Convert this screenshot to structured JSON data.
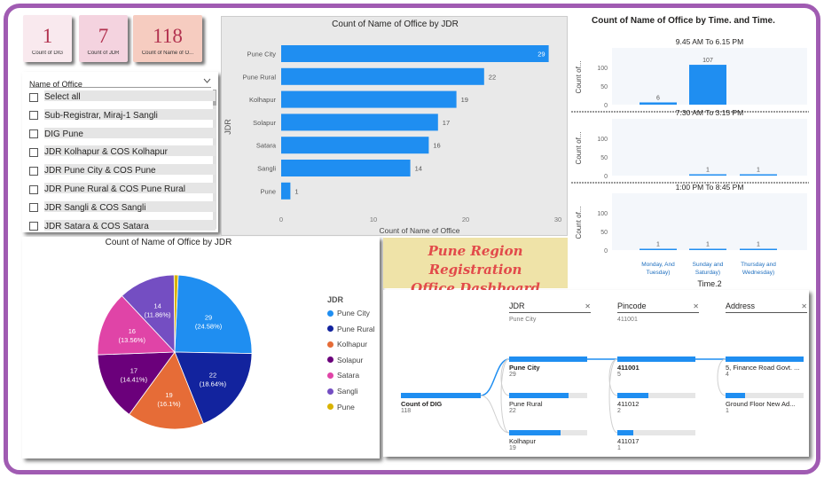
{
  "colors": {
    "frame": "#a05bb2",
    "bar": "#1f8ef1",
    "card_dig": "#f9e9ee",
    "card_jdr": "#f4d3df",
    "card_office": "#f6ccc0",
    "title_bg": "#efe3a8",
    "title_text": "#e24a4a"
  },
  "cards": [
    {
      "value": "1",
      "label": "Count of DIG"
    },
    {
      "value": "7",
      "label": "Count of JDR"
    },
    {
      "value": "118",
      "label": "Count of Name of O..."
    }
  ],
  "slicer": {
    "header": "Name of Office",
    "chevron_icon": "chevron-down-icon",
    "items": [
      "Select all",
      "Sub-Registrar, Miraj-1 Sangli",
      "DIG Pune",
      "JDR Kolhapur & COS Kolhapur",
      "JDR Pune City & COS Pune",
      "JDR Pune Rural & COS Pune Rural",
      "JDR Sangli & COS Sangli",
      "JDR Satara & COS Satara"
    ]
  },
  "dashboard_title": {
    "line1": "Pune Region Registration",
    "line2": "Office Dashboard"
  },
  "bar_panel": {
    "title": "Count of Name of Office by JDR",
    "ylabel": "JDR",
    "xlabel": "Count of Name of Office",
    "ticks": [
      "0",
      "10",
      "20",
      "30"
    ]
  },
  "pie_panel": {
    "title": "Count of Name of Office by JDR",
    "legend_title": "JDR"
  },
  "time_panel": {
    "title": "Count of Name of Office by Time. and Time.",
    "ylabel": "Count of...",
    "xlabel": "Time.2",
    "ticks": [
      "0",
      "50",
      "100"
    ],
    "categories": [
      "Monday, And Tuesday)",
      "Sunday and Saturday)",
      "Thursday and Wednesday)"
    ]
  },
  "decomp": {
    "columns": [
      {
        "header": "JDR",
        "selected": "Pune City"
      },
      {
        "header": "Pincode",
        "selected": "411001"
      },
      {
        "header": "Address",
        "selected": ""
      }
    ],
    "close_icon": "close-icon",
    "root": {
      "label": "Count of DIG",
      "value": "118"
    },
    "level1": [
      {
        "label": "Pune City",
        "value": "29",
        "fill": 1.0
      },
      {
        "label": "Pune Rural",
        "value": "22",
        "fill": 0.76
      },
      {
        "label": "Kolhapur",
        "value": "19",
        "fill": 0.66
      }
    ],
    "level2": [
      {
        "label": "411001",
        "value": "5",
        "fill": 1.0
      },
      {
        "label": "411012",
        "value": "2",
        "fill": 0.4
      },
      {
        "label": "411017",
        "value": "1",
        "fill": 0.2
      }
    ],
    "level3": [
      {
        "label": "5, Finance Road Govt. ...",
        "value": "4",
        "fill": 1.0
      },
      {
        "label": "Ground Floor New Ad...",
        "value": "1",
        "fill": 0.25
      }
    ]
  },
  "chart_data": [
    {
      "type": "bar",
      "title": "Count of Name of Office by JDR",
      "xlabel": "Count of Name of Office",
      "ylabel": "JDR",
      "categories": [
        "Pune City",
        "Pune Rural",
        "Kolhapur",
        "Solapur",
        "Satara",
        "Sangli",
        "Pune"
      ],
      "values": [
        29,
        22,
        19,
        17,
        16,
        14,
        1
      ],
      "xlim": [
        0,
        30
      ],
      "orientation": "horizontal"
    },
    {
      "type": "pie",
      "title": "Count of Name of Office by JDR",
      "categories": [
        "Pune City",
        "Pune Rural",
        "Kolhapur",
        "Solapur",
        "Satara",
        "Sangli",
        "Pune"
      ],
      "values": [
        29,
        22,
        19,
        17,
        16,
        14,
        1
      ],
      "labels": [
        "29\n(24.58%)",
        "22\n(18.64%)",
        "19\n(16.1%)",
        "17\n(14.41%)",
        "16\n(13.56%)",
        "14\n(11.86%)",
        ""
      ],
      "colors": [
        "#1f8ef1",
        "#12239e",
        "#e66c37",
        "#6b007b",
        "#e044a7",
        "#744ec2",
        "#d9b300"
      ],
      "legend": "right"
    },
    {
      "type": "bar",
      "title": "Count of Name of Office by Time. and Time.",
      "xlabel": "Time.2",
      "ylabel": "Count of...",
      "ylim": [
        0,
        100
      ],
      "categories": [
        "Monday, And Tuesday)",
        "Sunday and Saturday)",
        "Thursday and Wednesday)"
      ],
      "series": [
        {
          "name": "9.45 AM To 6.15 PM",
          "values": [
            6,
            107,
            null
          ]
        },
        {
          "name": "7:30 AM To 3:15 PM",
          "values": [
            null,
            1,
            1
          ]
        },
        {
          "name": "1:00 PM To 8:45 PM",
          "values": [
            1,
            1,
            1
          ]
        }
      ]
    }
  ]
}
